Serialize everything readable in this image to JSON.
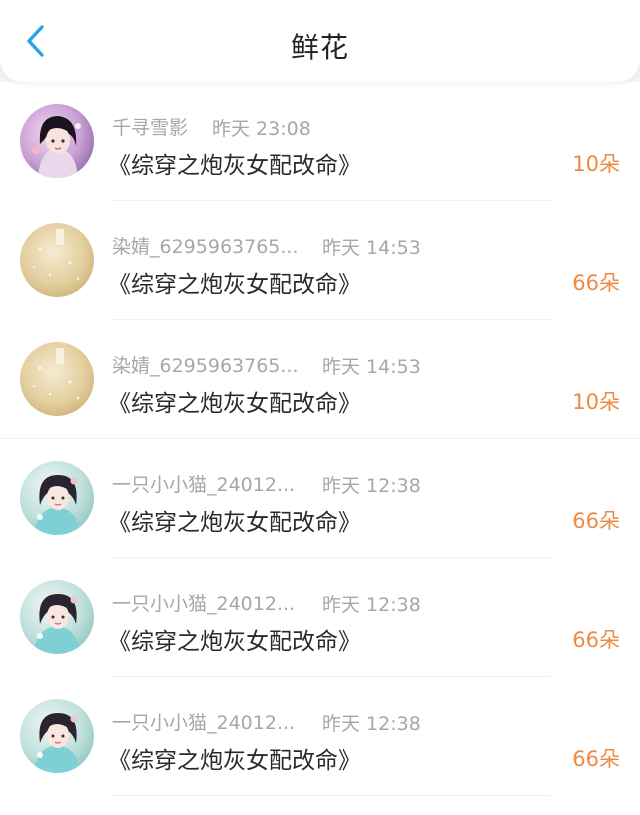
{
  "header": {
    "title": "鲜花",
    "back_icon": "chevron-left-icon",
    "accent_color": "#2aa0e8"
  },
  "flowers": [
    {
      "name": "千寻雪影",
      "time": "昨天 23:08",
      "book": "《综穿之炮灰女配改命》",
      "count": "10朵",
      "avatar": "girl-portrait-purple"
    },
    {
      "name": "染婧_6295963765...",
      "time": "昨天 14:53",
      "book": "《综穿之炮灰女配改命》",
      "count": "66朵",
      "avatar": "golden-sparkle"
    },
    {
      "name": "染婧_6295963765...",
      "time": "昨天 14:53",
      "book": "《综穿之炮灰女配改命》",
      "count": "10朵",
      "avatar": "golden-sparkle"
    },
    {
      "name": "一只小小猫_24012...",
      "time": "昨天 12:38",
      "book": "《综穿之炮灰女配改命》",
      "count": "66朵",
      "avatar": "girl-portrait-teal"
    },
    {
      "name": "一只小小猫_24012...",
      "time": "昨天 12:38",
      "book": "《综穿之炮灰女配改命》",
      "count": "66朵",
      "avatar": "girl-portrait-teal"
    },
    {
      "name": "一只小小猫_24012...",
      "time": "昨天 12:38",
      "book": "《综穿之炮灰女配改命》",
      "count": "66朵",
      "avatar": "girl-portrait-teal"
    }
  ],
  "colors": {
    "count": "#ef8a42",
    "meta": "#a7a7a7"
  }
}
